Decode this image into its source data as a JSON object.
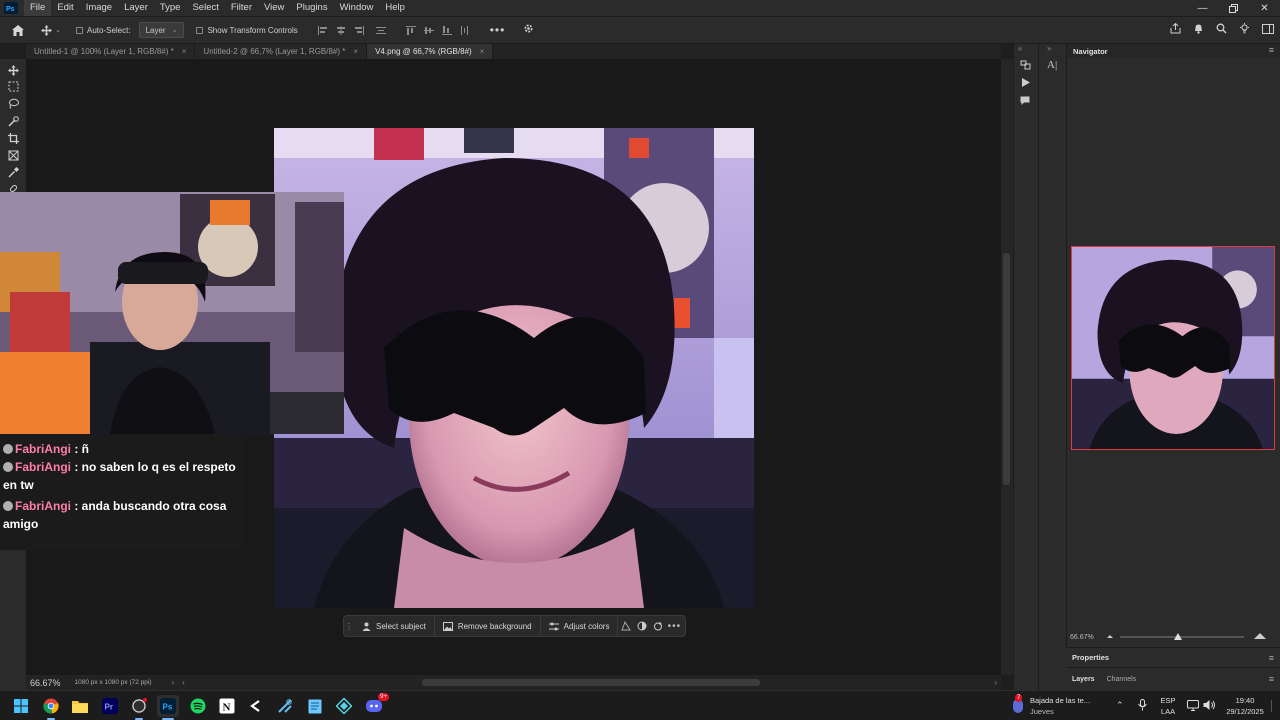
{
  "menubar": {
    "app_logo": "Ps",
    "items": [
      "File",
      "Edit",
      "Image",
      "Layer",
      "Type",
      "Select",
      "Filter",
      "View",
      "Plugins",
      "Window",
      "Help"
    ],
    "window_controls": [
      "minimize-icon",
      "restore-icon",
      "close-icon"
    ]
  },
  "options": {
    "auto_select_label": "Auto-Select:",
    "auto_select_value": "Layer",
    "show_transform_label": "Show Transform Controls"
  },
  "tabs": [
    {
      "label": "Untitled-1 @ 100% (Layer 1, RGB/8#) *",
      "active": false
    },
    {
      "label": "Untitled-2 @ 66,7% (Layer 1, RGB/8#) *",
      "active": false
    },
    {
      "label": "V4.png @ 66,7% (RGB/8#)",
      "active": true
    }
  ],
  "chat": {
    "messages": [
      {
        "user": "FabriAngi",
        "text": " : ñ"
      },
      {
        "user": "FabriAngi",
        "text": " : no saben lo q es el respeto en tw"
      },
      {
        "user": "FabriAngi",
        "text": " : anda buscando otra cosa amigo"
      }
    ]
  },
  "context_bar": {
    "select_subject": "Select subject",
    "remove_background": "Remove background",
    "adjust_colors": "Adjust colors"
  },
  "status": {
    "zoom": "66.67%",
    "doc_info": "1080 px x 1080 px (72 ppi)"
  },
  "navigator": {
    "title": "Navigator",
    "zoom": "66.67%"
  },
  "properties": {
    "title": "Properties"
  },
  "layers_panel": {
    "tab_layers": "Layers",
    "tab_channels": "Channels"
  },
  "taskbar": {
    "notification_title": "Bajada de las te...",
    "notification_sub": "Jueves",
    "lang_top": "ESP",
    "lang_bottom": "LAA",
    "time": "19:40",
    "date": "29/12/2025",
    "notif_badge": "7",
    "discord_badge": "9+"
  },
  "colors": {
    "accent_blue": "#2d7ff0",
    "ps_blue": "#31a8ff",
    "chat_user_pink": "#ff7ea6",
    "nav_frame_red": "#e03c3c"
  }
}
